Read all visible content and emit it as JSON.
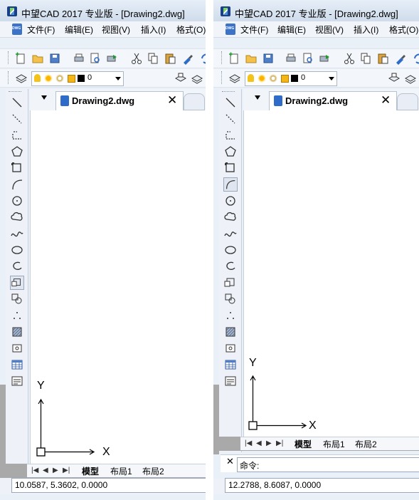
{
  "window": {
    "title": "中望CAD 2017 专业版 - [Drawing2.dwg]"
  },
  "menu": [
    "文件(F)",
    "编辑(E)",
    "视图(V)",
    "插入(I)",
    "格式(O)"
  ],
  "layer": {
    "name": "0",
    "color": "#000000"
  },
  "document_tab": {
    "label": "Drawing2.dwg",
    "close": "✕"
  },
  "layout_tabs": [
    "模型",
    "布局1",
    "布局2"
  ],
  "ucs": {
    "x_label": "X",
    "y_label": "Y"
  },
  "draw_tools": [
    "line-tool",
    "ray-tool",
    "polyline-tool",
    "polygon-tool",
    "rectangle-tool",
    "arc-tool",
    "circle-tool",
    "revision-cloud-tool",
    "spline-tool",
    "ellipse-tool",
    "ellipse-arc-tool",
    "insert-block-tool",
    "make-block-tool",
    "point-tool",
    "hatch-tool",
    "region-tool",
    "table-tool",
    "mtext-tool"
  ],
  "left_panel": {
    "coordinates": "10.0587, 5.3602, 0.0000",
    "active_tool": "insert-block-tool"
  },
  "right_panel": {
    "coordinates": "12.2788, 8.6087, 0.0000",
    "active_tool": "arc-tool",
    "command_prompt": "命令:"
  },
  "colors": {
    "ui_bg": "#eaf0f8",
    "canvas": "#ffffff",
    "strip": "#a9a9a9",
    "accent": "#2f6bc8"
  }
}
